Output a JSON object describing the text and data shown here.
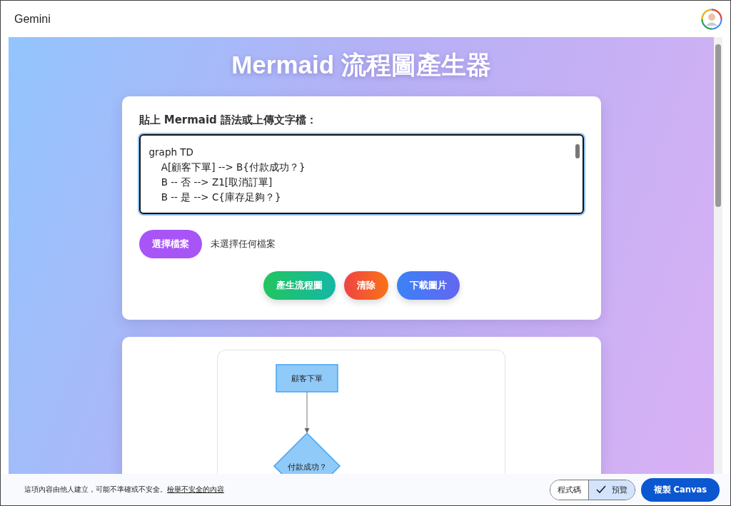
{
  "app": {
    "title": "Gemini"
  },
  "page": {
    "heading": "Mermaid 流程圖產生器"
  },
  "editor": {
    "label": "貼上 Mermaid 語法或上傳文字檔：",
    "lines": [
      "graph TD",
      "    A[顧客下單] --> B{付款成功？}",
      "    B -- 否 --> Z1[取消訂單]",
      "    B -- 是 --> C{庫存足夠？}"
    ]
  },
  "file_picker": {
    "button": "選擇檔案",
    "status": "未選擇任何檔案"
  },
  "actions": [
    {
      "label": "產生流程圖",
      "kind": "generate"
    },
    {
      "label": "清除",
      "kind": "clear"
    },
    {
      "label": "下載圖片",
      "kind": "download"
    }
  ],
  "diagram": {
    "nodes": [
      {
        "label": "顧客下單",
        "kind": "rect"
      },
      {
        "label": "付款成功？",
        "kind": "diamond"
      }
    ]
  },
  "footer": {
    "notice": "這項內容由他人建立，可能不準確或不安全。",
    "report_link": "檢舉不安全的內容",
    "view_tabs": [
      {
        "label": "程式碼",
        "selected": false
      },
      {
        "label": "預覽",
        "selected": true
      }
    ],
    "copy_button": "複製 Canvas"
  }
}
